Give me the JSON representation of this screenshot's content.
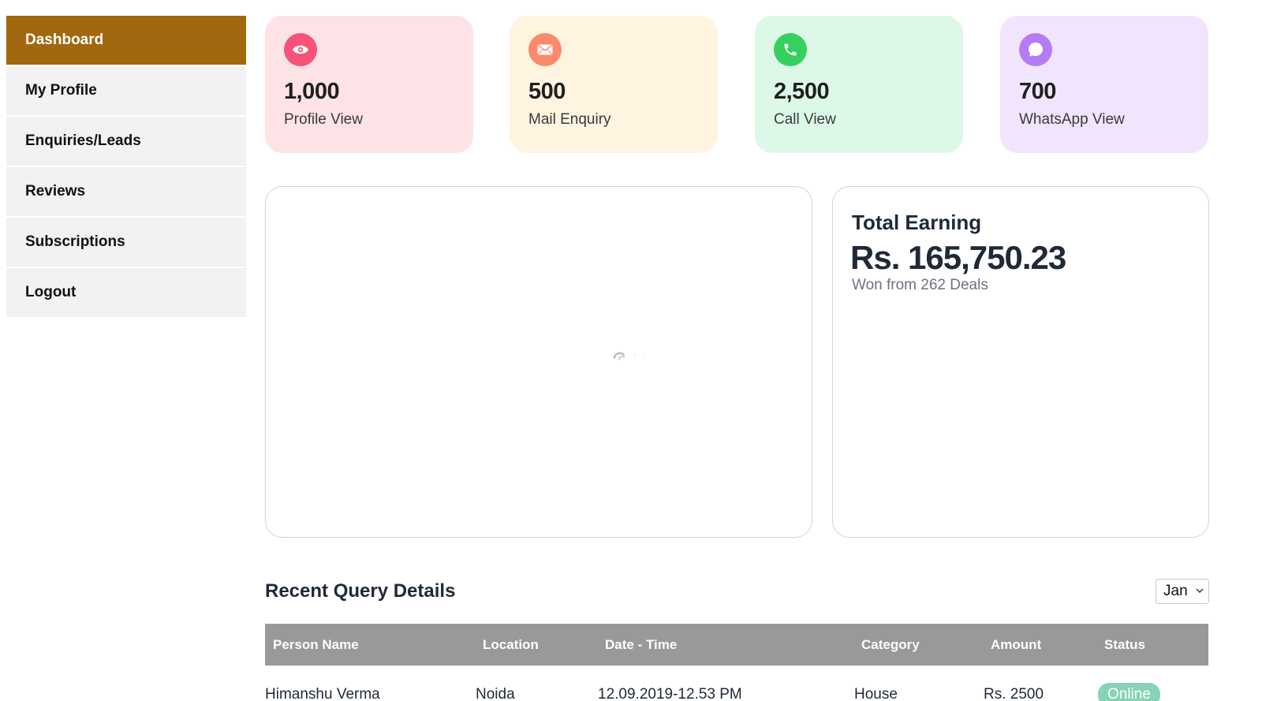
{
  "sidebar": {
    "items": [
      {
        "label": "Dashboard"
      },
      {
        "label": "My Profile"
      },
      {
        "label": "Enquiries/Leads"
      },
      {
        "label": "Reviews"
      },
      {
        "label": "Subscriptions"
      },
      {
        "label": "Logout"
      }
    ],
    "active_index": 0
  },
  "stats": [
    {
      "value": "1,000",
      "label": "Profile View",
      "icon": "eye-icon",
      "bg": "#fde2e6",
      "icon_bg": "#f6527a"
    },
    {
      "value": "500",
      "label": "Mail Enquiry",
      "icon": "mail-icon",
      "bg": "#fff4e0",
      "icon_bg": "#fa8a6c"
    },
    {
      "value": "2,500",
      "label": "Call View",
      "icon": "phone-icon",
      "bg": "#dcf9e8",
      "icon_bg": "#35d05e"
    },
    {
      "value": "700",
      "label": "WhatsApp View",
      "icon": "chat-bubble-icon",
      "bg": "#f1e5fd",
      "icon_bg": "#b47cf4"
    }
  ],
  "earning": {
    "title": "Total Earning",
    "amount": "Rs. 165,750.23",
    "subtitle": "Won from 262 Deals"
  },
  "recent_query": {
    "title": "Recent Query Details",
    "month": "Jan",
    "columns": [
      "Person Name",
      "Location",
      "Date - Time",
      "Category",
      "Amount",
      "Status"
    ],
    "rows": [
      {
        "name": "Himanshu Verma",
        "location": "Noida",
        "datetime": "12.09.2019-12.53 PM",
        "category": "House",
        "amount": "Rs. 2500",
        "status": "Online"
      }
    ]
  },
  "colors": {
    "accent": "#a2680f",
    "status_online": "#86d3b6",
    "table_header": "#999999"
  }
}
